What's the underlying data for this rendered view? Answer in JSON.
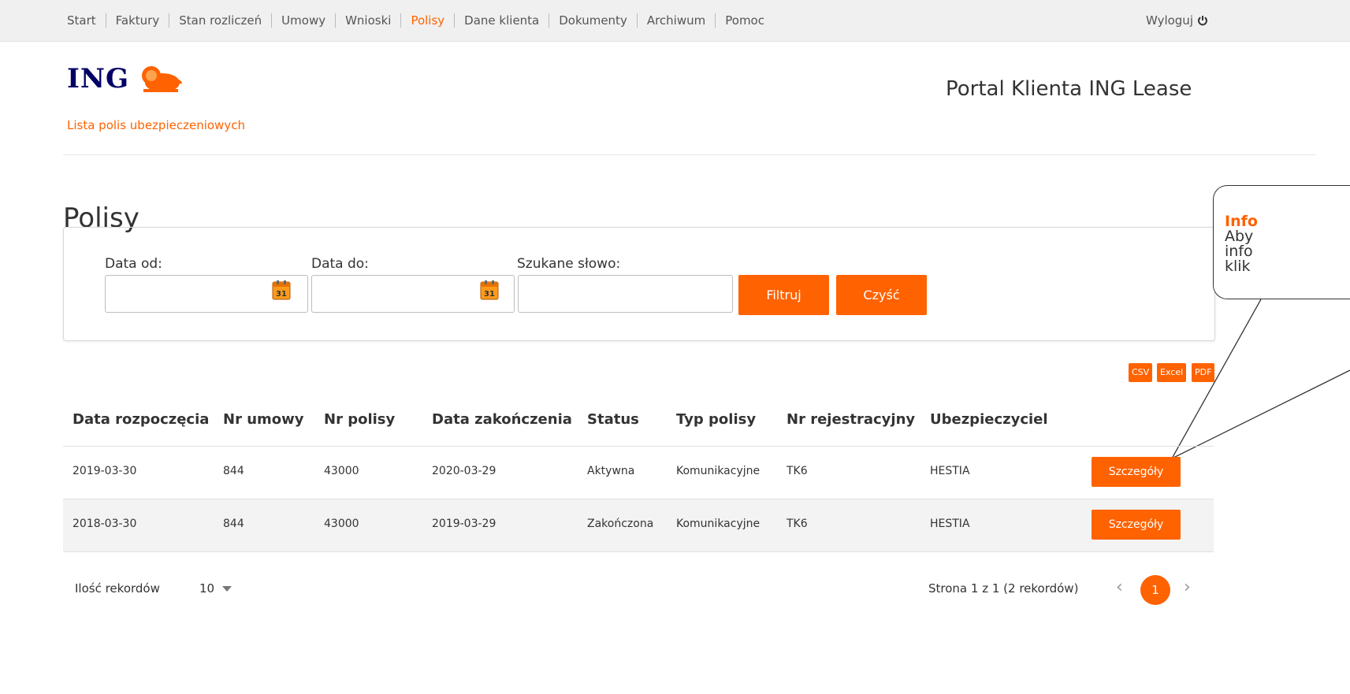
{
  "nav": {
    "items": [
      {
        "label": "Start"
      },
      {
        "label": "Faktury"
      },
      {
        "label": "Stan rozliczeń"
      },
      {
        "label": "Umowy"
      },
      {
        "label": "Wnioski"
      },
      {
        "label": "Polisy",
        "active": true
      },
      {
        "label": "Dane klienta"
      },
      {
        "label": "Dokumenty"
      },
      {
        "label": "Archiwum"
      },
      {
        "label": "Pomoc"
      }
    ],
    "logout_label": "Wyloguj",
    "logout_icon": "power-icon"
  },
  "header": {
    "logo_text": "ING",
    "logo_icon": "lion-icon",
    "portal_title": "Portal Klienta ING Lease",
    "subtitle": "Lista polis ubezpieczeniowych"
  },
  "page_title": "Polisy",
  "filters": {
    "date_from_label": "Data od:",
    "date_from_value": "",
    "date_to_label": "Data do:",
    "date_to_value": "",
    "search_label": "Szukane słowo:",
    "search_value": "",
    "calendar_day": "31",
    "filter_button": "Filtruj",
    "clear_button": "Czyść"
  },
  "tooltip": {
    "title": "Info",
    "lines": [
      "Aby",
      "info",
      "klik"
    ]
  },
  "export": [
    "CSV",
    "Excel",
    "PDF"
  ],
  "table": {
    "columns": [
      "Data rozpoczęcia",
      "Nr umowy",
      "Nr polisy",
      "Data zakończenia",
      "Status",
      "Typ polisy",
      "Nr rejestracyjny",
      "Ubezpieczyciel"
    ],
    "rows": [
      {
        "start": "2019-03-30",
        "contract": "844",
        "policy": "43000",
        "end": "2020-03-29",
        "status": "Aktywna",
        "type": "Komunikacyjne",
        "registration": "TK6",
        "insurer": "HESTIA",
        "details": "Szczegóły"
      },
      {
        "start": "2018-03-30",
        "contract": "844",
        "policy": "43000",
        "end": "2019-03-29",
        "status": "Zakończona",
        "type": "Komunikacyjne",
        "registration": "TK6",
        "insurer": "HESTIA",
        "details": "Szczegóły"
      }
    ]
  },
  "footer": {
    "records_label": "Ilość rekordów",
    "records_value": "10",
    "page_info": "Strona 1 z 1 (2 rekordów)",
    "prev": "‹",
    "next": "›",
    "current_page": "1"
  },
  "colors": {
    "accent": "#ff6200",
    "brand_navy": "#000066"
  }
}
